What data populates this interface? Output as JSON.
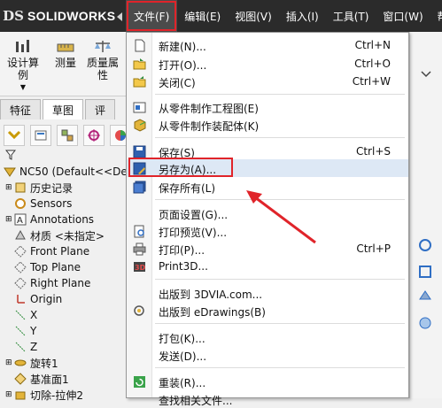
{
  "app": {
    "logo_text": "SOLIDWORKS",
    "logo_mark": "DS"
  },
  "menubar": [
    {
      "label": "文件(F)",
      "active": true
    },
    {
      "label": "编辑(E)"
    },
    {
      "label": "视图(V)"
    },
    {
      "label": "插入(I)"
    },
    {
      "label": "工具(T)"
    },
    {
      "label": "窗口(W)"
    },
    {
      "label": "帮"
    }
  ],
  "toolbar": {
    "design_calc": "设计算\n例",
    "measure": "测量",
    "mass_props": "质量属\n性"
  },
  "tabs": [
    "特征",
    "草图",
    "评"
  ],
  "tree": {
    "root": "NC50  (Default<<De",
    "items": [
      {
        "label": "历史记录",
        "icon": "history-icon"
      },
      {
        "label": "Sensors",
        "icon": "sensors-icon"
      },
      {
        "label": "Annotations",
        "icon": "annotations-icon"
      },
      {
        "label": "材质 <未指定>",
        "icon": "material-icon"
      },
      {
        "label": "Front Plane",
        "icon": "plane-icon"
      },
      {
        "label": "Top Plane",
        "icon": "plane-icon"
      },
      {
        "label": "Right Plane",
        "icon": "plane-icon"
      },
      {
        "label": "Origin",
        "icon": "origin-icon"
      },
      {
        "label": "X",
        "icon": "axis-icon"
      },
      {
        "label": "Y",
        "icon": "axis-icon"
      },
      {
        "label": "Z",
        "icon": "axis-icon"
      },
      {
        "label": "旋转1",
        "icon": "revolve-icon"
      },
      {
        "label": "基准面1",
        "icon": "plane-icon"
      },
      {
        "label": "切除-拉伸2",
        "icon": "cut-extrude-icon"
      }
    ]
  },
  "file_menu": {
    "items": [
      {
        "label": "新建(N)...",
        "shortcut": "Ctrl+N",
        "icon": "new-file-icon"
      },
      {
        "label": "打开(O)...",
        "shortcut": "Ctrl+O",
        "icon": "open-folder-icon"
      },
      {
        "label": "关闭(C)",
        "shortcut": "Ctrl+W",
        "icon": "close-folder-icon"
      },
      {
        "label": "从零件制作工程图(E)",
        "shortcut": "",
        "icon": "make-drawing-icon"
      },
      {
        "label": "从零件制作装配体(K)",
        "shortcut": "",
        "icon": "make-assembly-icon"
      },
      {
        "label": "保存(S)",
        "shortcut": "Ctrl+S",
        "icon": "save-icon"
      },
      {
        "label": "另存为(A)...",
        "shortcut": "",
        "icon": "save-as-icon",
        "highlight": true
      },
      {
        "label": "保存所有(L)",
        "shortcut": "",
        "icon": "save-all-icon"
      },
      {
        "label": "页面设置(G)...",
        "shortcut": "",
        "icon": ""
      },
      {
        "label": "打印预览(V)...",
        "shortcut": "",
        "icon": "print-preview-icon"
      },
      {
        "label": "打印(P)...",
        "shortcut": "Ctrl+P",
        "icon": "print-icon"
      },
      {
        "label": "Print3D...",
        "shortcut": "",
        "icon": "print3d-icon"
      },
      {
        "label": "出版到 3DVIA.com...",
        "shortcut": "",
        "icon": ""
      },
      {
        "label": "出版到 eDrawings(B)",
        "shortcut": "",
        "icon": "edrawings-icon"
      },
      {
        "label": "打包(K)...",
        "shortcut": "",
        "icon": ""
      },
      {
        "label": "发送(D)...",
        "shortcut": "",
        "icon": ""
      },
      {
        "label": "重装(R)...",
        "shortcut": "",
        "icon": "reload-icon"
      },
      {
        "label": "查找相关文件...",
        "shortcut": "",
        "icon": ""
      }
    ]
  },
  "colors": {
    "titlebar": "#2b2b2b",
    "highlight_red": "#e0242a",
    "accent_blue": "#1a5fb4"
  }
}
